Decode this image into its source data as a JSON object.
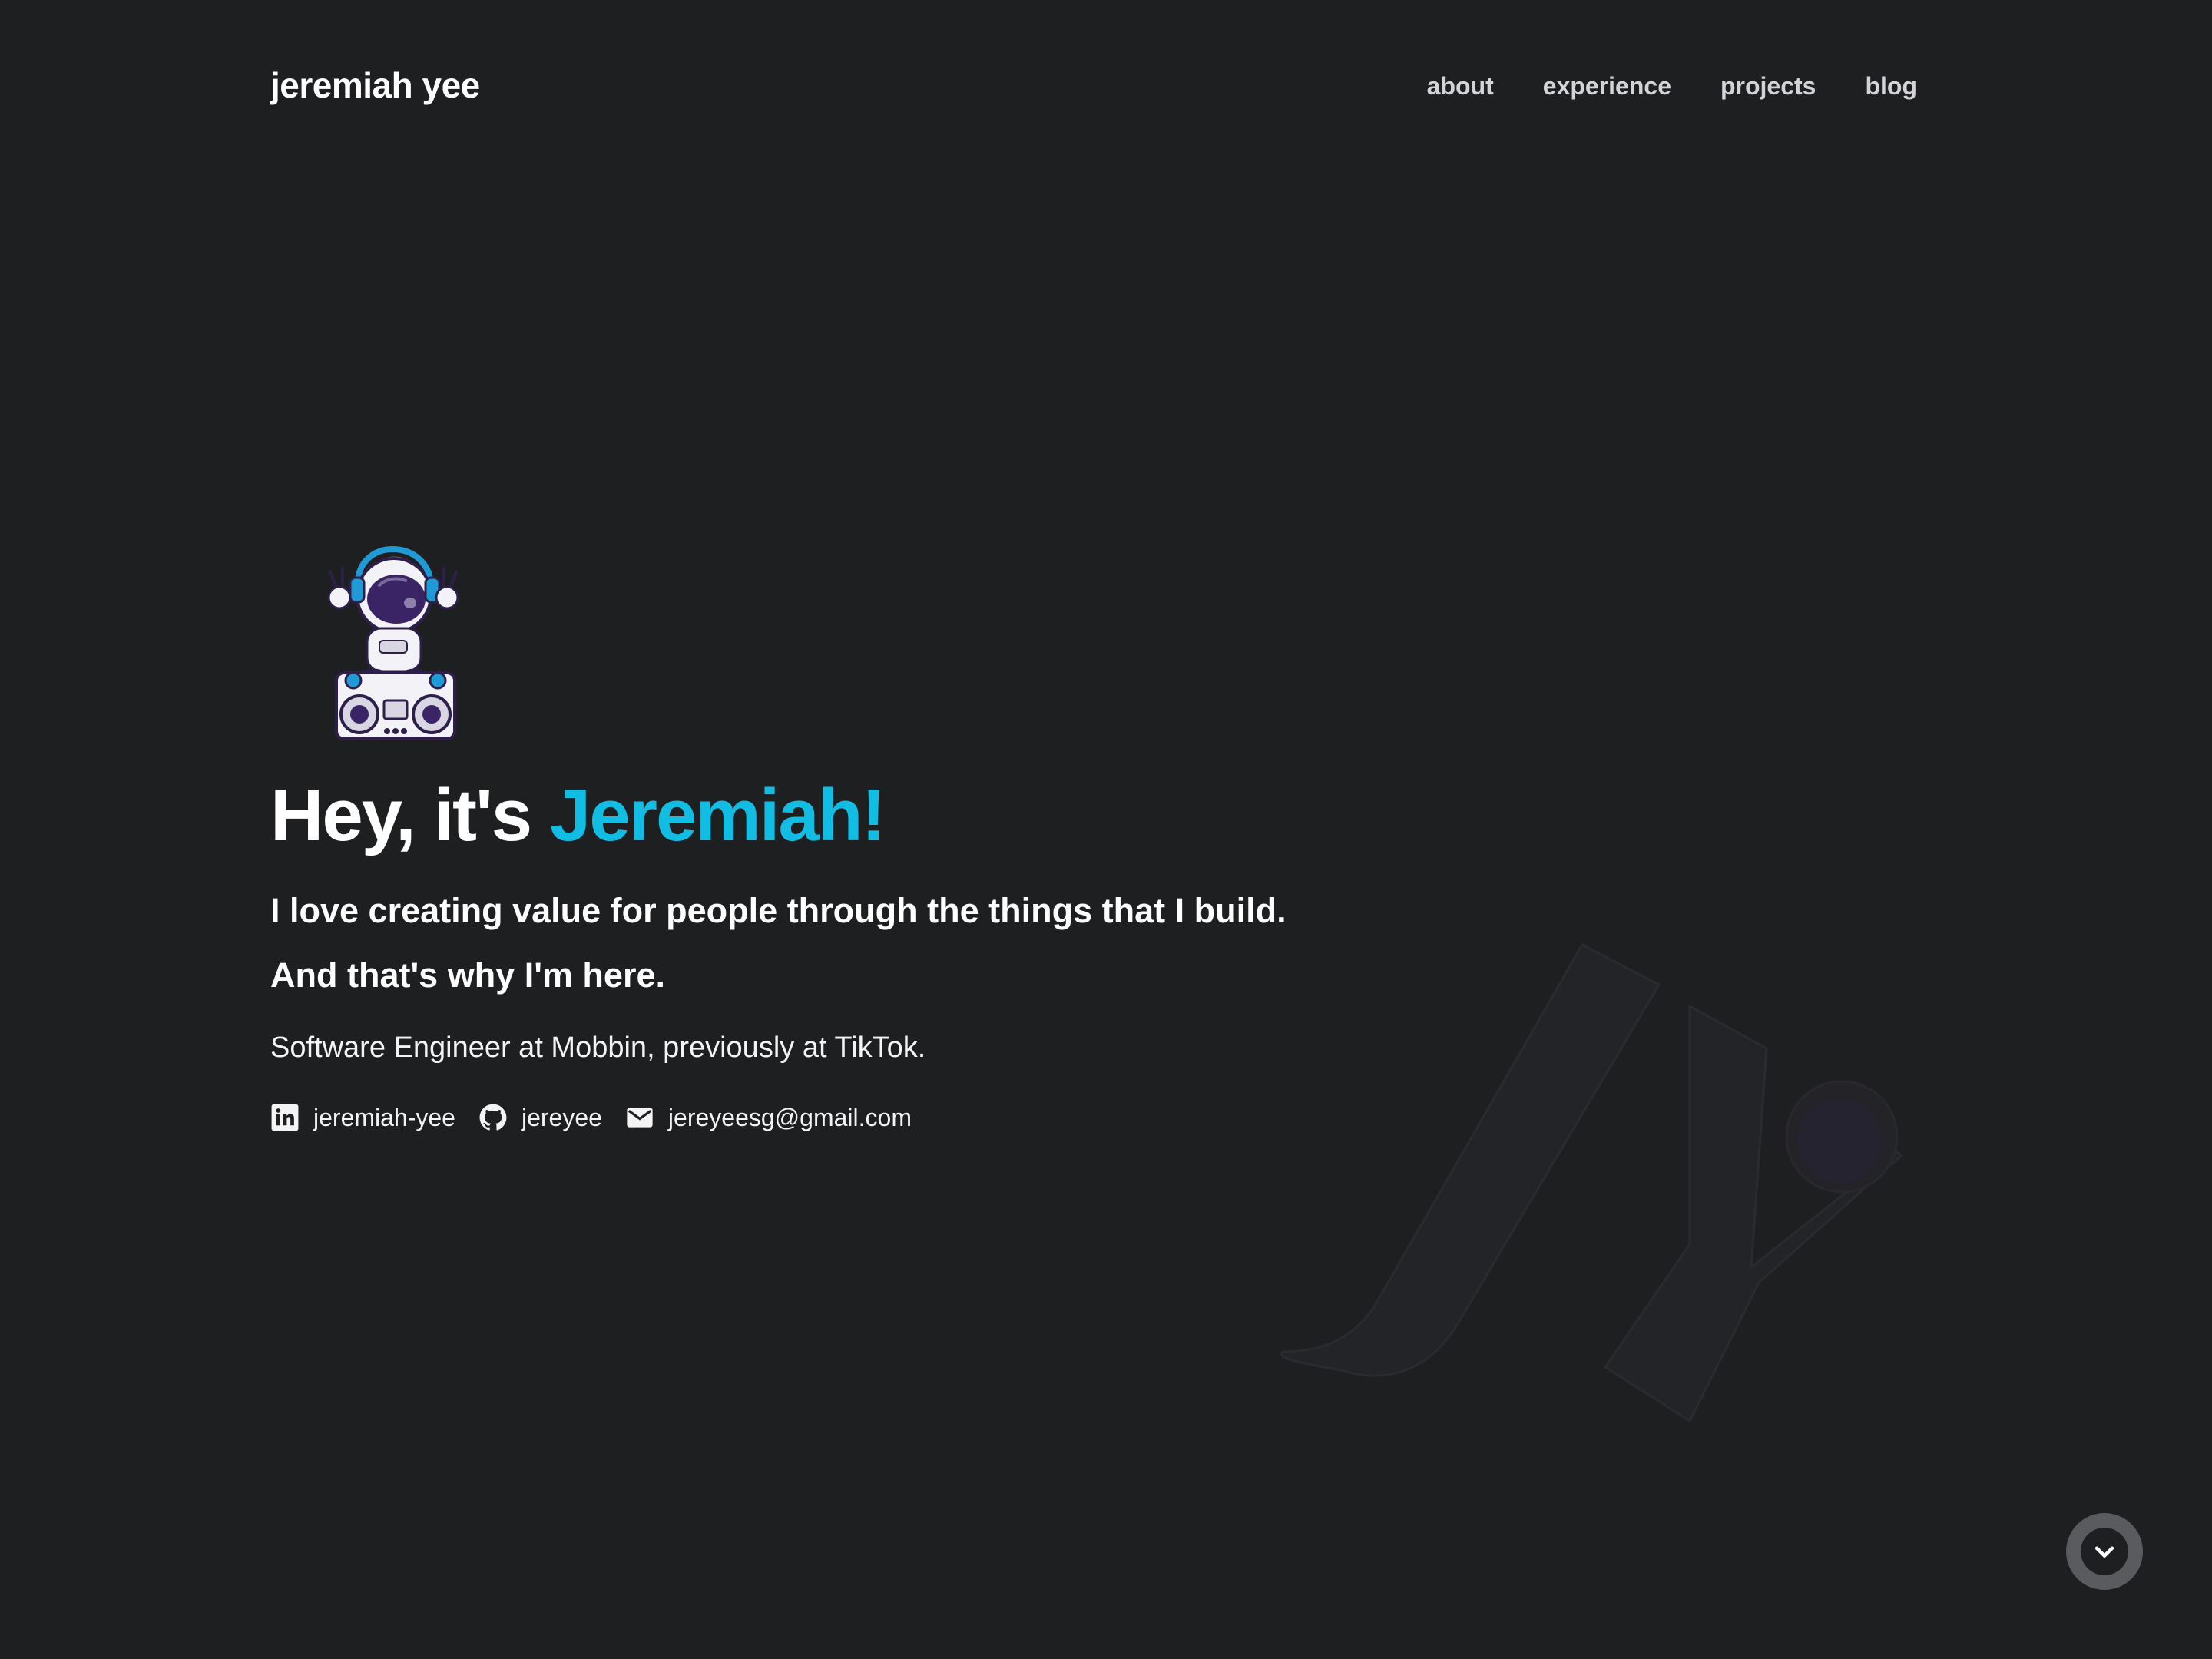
{
  "brand": {
    "name": "jeremiah yee"
  },
  "nav": {
    "items": [
      {
        "label": "about"
      },
      {
        "label": "experience"
      },
      {
        "label": "projects"
      },
      {
        "label": "blog"
      }
    ]
  },
  "hero": {
    "headline_prefix": "Hey, it's ",
    "headline_name": "Jeremiah!",
    "tagline_line1": "I love creating value for people through the things that I build.",
    "tagline_line2": "And that's why I'm here.",
    "role": "Software Engineer at Mobbin, previously at TikTok.",
    "accent_color": "#12bde4"
  },
  "socials": [
    {
      "icon": "linkedin-icon",
      "label": "jeremiah-yee"
    },
    {
      "icon": "github-icon",
      "label": "jereyee"
    },
    {
      "icon": "mail-icon",
      "label": "jereyeesg@gmail.com"
    }
  ],
  "scroll_button": {
    "icon": "chevron-down-icon"
  },
  "colors": {
    "background": "#1e1f21",
    "text": "#ffffff",
    "nav_text": "#d4d4d8",
    "accent": "#12bde4"
  }
}
